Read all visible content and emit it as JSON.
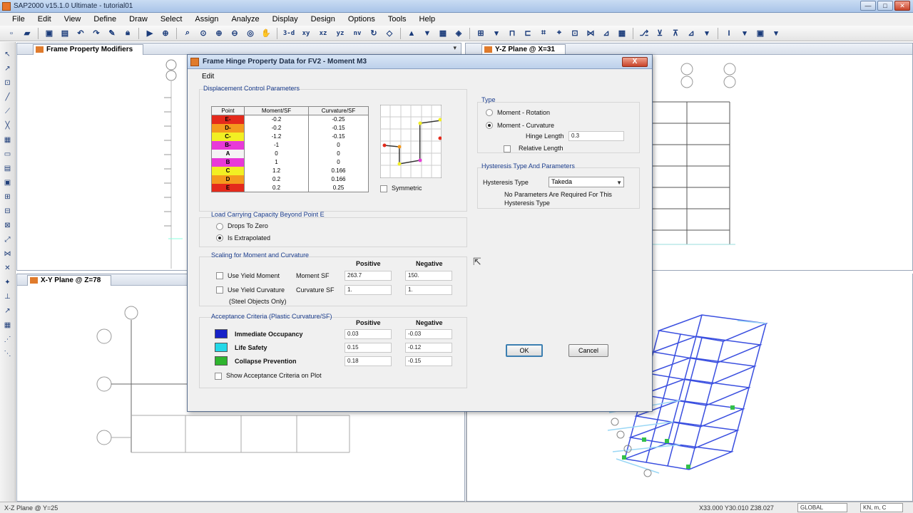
{
  "window": {
    "title": "SAP2000 v15.1.0 Ultimate  - tutorial01",
    "min": "—",
    "max": "□",
    "close": "✕"
  },
  "menu": [
    "File",
    "Edit",
    "View",
    "Define",
    "Draw",
    "Select",
    "Assign",
    "Analyze",
    "Display",
    "Design",
    "Options",
    "Tools",
    "Help"
  ],
  "toolbar": {
    "views": [
      "3-d",
      "xy",
      "xz",
      "yz",
      "nv"
    ]
  },
  "panels": {
    "top_left": {
      "tab": "Frame Property Modifiers"
    },
    "top_right": {
      "tab": "Y-Z Plane @ X=31"
    },
    "bottom_left": {
      "tab": "X-Y Plane @ Z=78"
    }
  },
  "status": {
    "left": "X-Z Plane @ Y=25",
    "coords": "X33.000  Y30.010  Z38.027",
    "coord_system": "GLOBAL",
    "units": "KN, m, C"
  },
  "dialog": {
    "title": "Frame Hinge Property Data for FV2 - Moment M3",
    "close": "X",
    "menu_edit": "Edit",
    "displacement": {
      "label": "Displacement Control Parameters",
      "columns": [
        "Point",
        "Moment/SF",
        "Curvature/SF"
      ],
      "rows": [
        {
          "point": "E-",
          "moment": "-0.2",
          "curvature": "-0.25",
          "color": "#e42a1c"
        },
        {
          "point": "D-",
          "moment": "-0.2",
          "curvature": "-0.15",
          "color": "#f49a1e"
        },
        {
          "point": "C-",
          "moment": "-1.2",
          "curvature": "-0.15",
          "color": "#f2ef23"
        },
        {
          "point": "B-",
          "moment": "-1",
          "curvature": "0",
          "color": "#e83ad8"
        },
        {
          "point": "A",
          "moment": "0",
          "curvature": "0",
          "color": "#f4f4f4"
        },
        {
          "point": "B",
          "moment": "1",
          "curvature": "0",
          "color": "#e83ad8"
        },
        {
          "point": "C",
          "moment": "1.2",
          "curvature": "0.166",
          "color": "#f2ef23"
        },
        {
          "point": "D",
          "moment": "0.2",
          "curvature": "0.166",
          "color": "#f49a1e"
        },
        {
          "point": "E",
          "moment": "0.2",
          "curvature": "0.25",
          "color": "#e42a1c"
        }
      ],
      "symmetric": "Symmetric"
    },
    "load_capacity": {
      "label": "Load Carrying Capacity Beyond Point E",
      "opt1": "Drops To Zero",
      "opt2": "Is Extrapolated"
    },
    "scaling": {
      "label": "Scaling for Moment and Curvature",
      "positive": "Positive",
      "negative": "Negative",
      "use_yield_moment": "Use Yield Moment",
      "moment_sf": "Moment SF",
      "moment_pos": "263.7",
      "moment_neg": "150.",
      "use_yield_curvature": "Use Yield Curvature",
      "curvature_sf": "Curvature SF",
      "curv_pos": "1.",
      "curv_neg": "1.",
      "steel_only": "(Steel Objects Only)"
    },
    "acceptance": {
      "label": "Acceptance Criteria (Plastic Curvature/SF)",
      "positive": "Positive",
      "negative": "Negative",
      "io": {
        "label": "Immediate Occupancy",
        "pos": "0.03",
        "neg": "-0.03",
        "color": "#1722c8"
      },
      "ls": {
        "label": "Life Safety",
        "pos": "0.15",
        "neg": "-0.12",
        "color": "#23d8e8"
      },
      "cp": {
        "label": "Collapse Prevention",
        "pos": "0.18",
        "neg": "-0.15",
        "color": "#2fb52f"
      },
      "show_on_plot": "Show Acceptance Criteria on Plot"
    },
    "type": {
      "label": "Type",
      "opt1": "Moment - Rotation",
      "opt2": "Moment - Curvature",
      "hinge_length_label": "Hinge Length",
      "hinge_length": "0.3",
      "relative_length": "Relative Length"
    },
    "hysteresis": {
      "label": "Hysteresis Type And Parameters",
      "type_label": "Hysteresis Type",
      "type_value": "Takeda",
      "note1": "No Parameters Are Required For This",
      "note2": "Hysteresis Type"
    },
    "ok": "OK",
    "cancel": "Cancel"
  }
}
